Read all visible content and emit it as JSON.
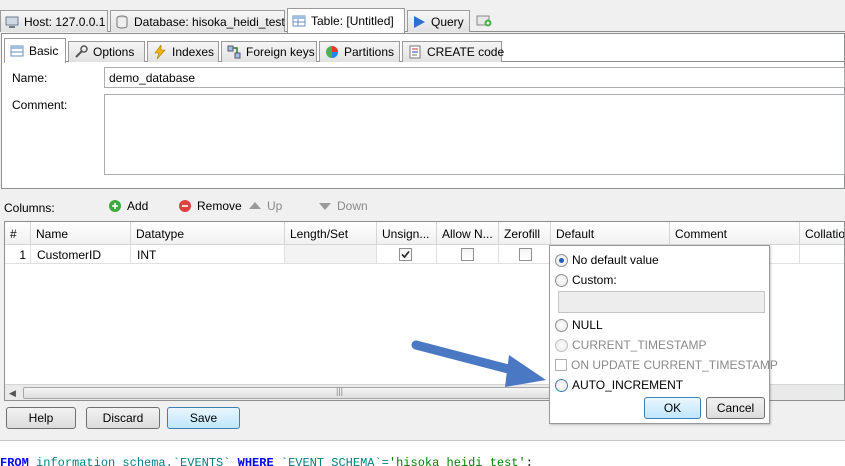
{
  "top_tabs": [
    {
      "label": "Host: 127.0.0.1",
      "icon": "host-icon"
    },
    {
      "label": "Database: hisoka_heidi_test",
      "icon": "database-icon"
    },
    {
      "label": "Table: [Untitled]",
      "icon": "table-icon",
      "active": true
    },
    {
      "label": "Query",
      "icon": "play-icon"
    }
  ],
  "sub_tabs": [
    {
      "label": "Basic",
      "active": true
    },
    {
      "label": "Options"
    },
    {
      "label": "Indexes"
    },
    {
      "label": "Foreign keys"
    },
    {
      "label": "Partitions"
    },
    {
      "label": "CREATE code"
    }
  ],
  "form": {
    "name_label": "Name:",
    "name_value": "demo_database",
    "comment_label": "Comment:",
    "comment_value": ""
  },
  "columns_toolbar": {
    "label": "Columns:",
    "add": "Add",
    "remove": "Remove",
    "up": "Up",
    "down": "Down"
  },
  "grid": {
    "headers": [
      "#",
      "Name",
      "Datatype",
      "Length/Set",
      "Unsign...",
      "Allow N...",
      "Zerofill",
      "Default",
      "Comment",
      "Collatio"
    ],
    "rows": [
      {
        "num": "1",
        "name": "CustomerID",
        "datatype": "INT",
        "length": "",
        "unsigned": true,
        "allow_null": false,
        "zerofill": false
      }
    ]
  },
  "default_popup": {
    "options": {
      "no_default": "No default value",
      "custom": "Custom:",
      "null": "NULL",
      "current_timestamp": "CURRENT_TIMESTAMP",
      "on_update": "ON UPDATE CURRENT_TIMESTAMP",
      "auto_increment": "AUTO_INCREMENT"
    },
    "selected": "no_default",
    "custom_value": "",
    "ok": "OK",
    "cancel": "Cancel"
  },
  "buttons": {
    "help": "Help",
    "discard": "Discard",
    "save": "Save"
  },
  "sql_log": {
    "kw1": "FROM",
    "t1": " information_schema.`EVENTS` ",
    "kw2": "WHERE",
    "t2": " `EVENT_SCHEMA`=",
    "str": "'hisoka_heidi_test'",
    "t3": ";"
  },
  "colors": {
    "accent": "#1d5fbb",
    "arrow": "#4a78c2",
    "sql_keyword": "#0000ff",
    "sql_string": "#008000"
  }
}
